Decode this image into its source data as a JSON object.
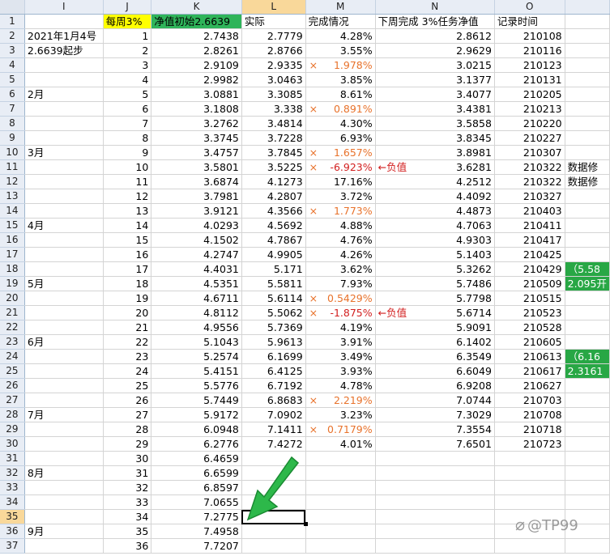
{
  "columns": [
    "I",
    "J",
    "K",
    "L",
    "M",
    "N",
    "O",
    ""
  ],
  "header_row": {
    "row": "1",
    "cells": [
      "",
      "每周3%",
      "净值初始2.6639",
      "实际",
      "完成情况",
      "下周完成  3%任务净值",
      "记录时间",
      ""
    ]
  },
  "rows": [
    {
      "r": "2",
      "i": "2021年1月4号",
      "j": "1",
      "k": "2.7438",
      "l": "2.7779",
      "mx": "",
      "m": "4.28%",
      "mt": "norm",
      "note": "",
      "n": "2.8612",
      "o": "210108",
      "p": "",
      "pg": false
    },
    {
      "r": "3",
      "i": "2.6639起步",
      "j": "2",
      "k": "2.8261",
      "l": "2.8766",
      "mx": "",
      "m": "3.55%",
      "mt": "norm",
      "note": "",
      "n": "2.9629",
      "o": "210116",
      "p": "",
      "pg": false
    },
    {
      "r": "4",
      "i": "",
      "j": "3",
      "k": "2.9109",
      "l": "2.9335",
      "mx": "×",
      "m": "1.978%",
      "mt": "x",
      "note": "",
      "n": "3.0215",
      "o": "210123",
      "p": "",
      "pg": false
    },
    {
      "r": "5",
      "i": "",
      "j": "4",
      "k": "2.9982",
      "l": "3.0463",
      "mx": "",
      "m": "3.85%",
      "mt": "norm",
      "note": "",
      "n": "3.1377",
      "o": "210131",
      "p": "",
      "pg": false
    },
    {
      "r": "6",
      "i": "2月",
      "j": "5",
      "k": "3.0881",
      "l": "3.3085",
      "mx": "",
      "m": "8.61%",
      "mt": "norm",
      "note": "",
      "n": "3.4077",
      "o": "210205",
      "p": "",
      "pg": false
    },
    {
      "r": "7",
      "i": "",
      "j": "6",
      "k": "3.1808",
      "l": "3.338",
      "mx": "×",
      "m": "0.891%",
      "mt": "x",
      "note": "",
      "n": "3.4381",
      "o": "210213",
      "p": "",
      "pg": false
    },
    {
      "r": "8",
      "i": "",
      "j": "7",
      "k": "3.2762",
      "l": "3.4814",
      "mx": "",
      "m": "4.30%",
      "mt": "norm",
      "note": "",
      "n": "3.5858",
      "o": "210220",
      "p": "",
      "pg": false
    },
    {
      "r": "9",
      "i": "",
      "j": "8",
      "k": "3.3745",
      "l": "3.7228",
      "mx": "",
      "m": "6.93%",
      "mt": "norm",
      "note": "",
      "n": "3.8345",
      "o": "210227",
      "p": "",
      "pg": false
    },
    {
      "r": "10",
      "i": "3月",
      "j": "9",
      "k": "3.4757",
      "l": "3.7845",
      "mx": "×",
      "m": "1.657%",
      "mt": "x",
      "note": "",
      "n": "3.8981",
      "o": "210307",
      "p": "",
      "pg": false
    },
    {
      "r": "11",
      "i": "",
      "j": "10",
      "k": "3.5801",
      "l": "3.5225",
      "mx": "×",
      "m": "-6.923%",
      "mt": "neg",
      "note": "←负值",
      "n": "3.6281",
      "o": "210322",
      "p": "数据修",
      "pg": false
    },
    {
      "r": "12",
      "i": "",
      "j": "11",
      "k": "3.6874",
      "l": "4.1273",
      "mx": "",
      "m": "17.16%",
      "mt": "norm",
      "note": "",
      "n": "4.2512",
      "o": "210322",
      "p": "数据修",
      "pg": false
    },
    {
      "r": "13",
      "i": "",
      "j": "12",
      "k": "3.7981",
      "l": "4.2807",
      "mx": "",
      "m": "3.72%",
      "mt": "norm",
      "note": "",
      "n": "4.4092",
      "o": "210327",
      "p": "",
      "pg": false
    },
    {
      "r": "14",
      "i": "",
      "j": "13",
      "k": "3.9121",
      "l": "4.3566",
      "mx": "×",
      "m": "1.773%",
      "mt": "x",
      "note": "",
      "n": "4.4873",
      "o": "210403",
      "p": "",
      "pg": false
    },
    {
      "r": "15",
      "i": "4月",
      "j": "14",
      "k": "4.0293",
      "l": "4.5692",
      "mx": "",
      "m": "4.88%",
      "mt": "norm",
      "note": "",
      "n": "4.7063",
      "o": "210411",
      "p": "",
      "pg": false
    },
    {
      "r": "16",
      "i": "",
      "j": "15",
      "k": "4.1502",
      "l": "4.7867",
      "mx": "",
      "m": "4.76%",
      "mt": "norm",
      "note": "",
      "n": "4.9303",
      "o": "210417",
      "p": "",
      "pg": false
    },
    {
      "r": "17",
      "i": "",
      "j": "16",
      "k": "4.2747",
      "l": "4.9905",
      "mx": "",
      "m": "4.26%",
      "mt": "norm",
      "note": "",
      "n": "5.1403",
      "o": "210425",
      "p": "",
      "pg": false
    },
    {
      "r": "18",
      "i": "",
      "j": "17",
      "k": "4.4031",
      "l": "5.171",
      "mx": "",
      "m": "3.62%",
      "mt": "norm",
      "note": "",
      "n": "5.3262",
      "o": "210429",
      "p": "（5.58",
      "pg": true
    },
    {
      "r": "19",
      "i": "5月",
      "j": "18",
      "k": "4.5351",
      "l": "5.5811",
      "mx": "",
      "m": "7.93%",
      "mt": "norm",
      "note": "",
      "n": "5.7486",
      "o": "210509",
      "p": "2.095开",
      "pg": true
    },
    {
      "r": "20",
      "i": "",
      "j": "19",
      "k": "4.6711",
      "l": "5.6114",
      "mx": "×",
      "m": "0.5429%",
      "mt": "x",
      "note": "",
      "n": "5.7798",
      "o": "210515",
      "p": "",
      "pg": false
    },
    {
      "r": "21",
      "i": "",
      "j": "20",
      "k": "4.8112",
      "l": "5.5062",
      "mx": "×",
      "m": "-1.875%",
      "mt": "neg",
      "note": "←负值",
      "n": "5.6714",
      "o": "210523",
      "p": "",
      "pg": false
    },
    {
      "r": "22",
      "i": "",
      "j": "21",
      "k": "4.9556",
      "l": "5.7369",
      "mx": "",
      "m": "4.19%",
      "mt": "norm",
      "note": "",
      "n": "5.9091",
      "o": "210528",
      "p": "",
      "pg": false
    },
    {
      "r": "23",
      "i": "6月",
      "j": "22",
      "k": "5.1043",
      "l": "5.9613",
      "mx": "",
      "m": "3.91%",
      "mt": "norm",
      "note": "",
      "n": "6.1402",
      "o": "210605",
      "p": "",
      "pg": false
    },
    {
      "r": "24",
      "i": "",
      "j": "23",
      "k": "5.2574",
      "l": "6.1699",
      "mx": "",
      "m": "3.49%",
      "mt": "norm",
      "note": "",
      "n": "6.3549",
      "o": "210613",
      "p": "（6.16",
      "pg": true
    },
    {
      "r": "25",
      "i": "",
      "j": "24",
      "k": "5.4151",
      "l": "6.4125",
      "mx": "",
      "m": "3.93%",
      "mt": "norm",
      "note": "",
      "n": "6.6049",
      "o": "210617",
      "p": "2.3161",
      "pg": true
    },
    {
      "r": "26",
      "i": "",
      "j": "25",
      "k": "5.5776",
      "l": "6.7192",
      "mx": "",
      "m": "4.78%",
      "mt": "norm",
      "note": "",
      "n": "6.9208",
      "o": "210627",
      "p": "",
      "pg": false
    },
    {
      "r": "27",
      "i": "",
      "j": "26",
      "k": "5.7449",
      "l": "6.8683",
      "mx": "×",
      "m": "2.219%",
      "mt": "x",
      "note": "",
      "n": "7.0744",
      "o": "210703",
      "p": "",
      "pg": false
    },
    {
      "r": "28",
      "i": "7月",
      "j": "27",
      "k": "5.9172",
      "l": "7.0902",
      "mx": "",
      "m": "3.23%",
      "mt": "norm",
      "note": "",
      "n": "7.3029",
      "o": "210708",
      "p": "",
      "pg": false
    },
    {
      "r": "29",
      "i": "",
      "j": "28",
      "k": "6.0948",
      "l": "7.1411",
      "mx": "×",
      "m": "0.7179%",
      "mt": "x",
      "note": "",
      "n": "7.3554",
      "o": "210718",
      "p": "",
      "pg": false
    },
    {
      "r": "30",
      "i": "",
      "j": "29",
      "k": "6.2776",
      "l": "7.4272",
      "mx": "",
      "m": "4.01%",
      "mt": "norm",
      "note": "",
      "n": "7.6501",
      "o": "210723",
      "p": "",
      "pg": false
    },
    {
      "r": "31",
      "i": "",
      "j": "30",
      "k": "6.4659",
      "l": "",
      "mx": "",
      "m": "",
      "mt": "norm",
      "note": "",
      "n": "",
      "o": "",
      "p": "",
      "pg": false
    },
    {
      "r": "32",
      "i": "8月",
      "j": "31",
      "k": "6.6599",
      "l": "",
      "mx": "",
      "m": "",
      "mt": "norm",
      "note": "",
      "n": "",
      "o": "",
      "p": "",
      "pg": false
    },
    {
      "r": "33",
      "i": "",
      "j": "32",
      "k": "6.8597",
      "l": "",
      "mx": "",
      "m": "",
      "mt": "norm",
      "note": "",
      "n": "",
      "o": "",
      "p": "",
      "pg": false
    },
    {
      "r": "34",
      "i": "",
      "j": "33",
      "k": "7.0655",
      "l": "",
      "mx": "",
      "m": "",
      "mt": "norm",
      "note": "",
      "n": "",
      "o": "",
      "p": "",
      "pg": false
    },
    {
      "r": "35",
      "i": "",
      "j": "34",
      "k": "7.2775",
      "l": "",
      "mx": "",
      "m": "",
      "mt": "norm",
      "note": "",
      "n": "",
      "o": "",
      "p": "",
      "pg": false
    },
    {
      "r": "36",
      "i": "9月",
      "j": "35",
      "k": "7.4958",
      "l": "",
      "mx": "",
      "m": "",
      "mt": "norm",
      "note": "",
      "n": "",
      "o": "",
      "p": "",
      "pg": false
    },
    {
      "r": "37",
      "i": "",
      "j": "36",
      "k": "7.7207",
      "l": "",
      "mx": "",
      "m": "",
      "mt": "norm",
      "note": "",
      "n": "",
      "o": "",
      "p": "",
      "pg": false
    }
  ],
  "selection": {
    "row": "35",
    "column": "L"
  },
  "watermark": "@TP99",
  "colors": {
    "highlight_yellow": "#ffff00",
    "highlight_green": "#2fb45a",
    "warn_orange": "#e8722b",
    "negative_red": "#d21e1e",
    "arrow_green": "#2db84a"
  }
}
